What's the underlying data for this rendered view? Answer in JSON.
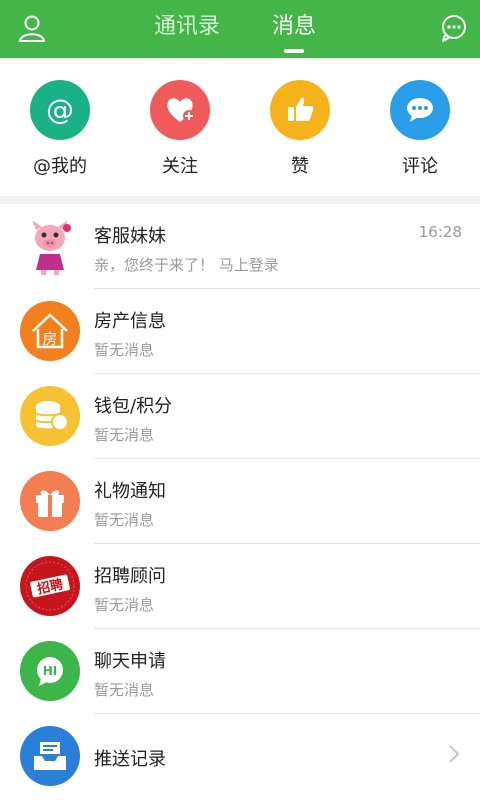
{
  "header": {
    "tabs": [
      {
        "label": "通讯录",
        "active": false
      },
      {
        "label": "消息",
        "active": true
      }
    ],
    "left_icon": "person-icon",
    "right_icon": "chat-bubble-icon",
    "bg_color": "#44b549"
  },
  "quick_actions": [
    {
      "label": "@我的",
      "icon": "at-sign-icon",
      "color": "#1ab184"
    },
    {
      "label": "关注",
      "icon": "heart-plus-icon",
      "color": "#f05a5a"
    },
    {
      "label": "赞",
      "icon": "thumbs-up-icon",
      "color": "#f6b21a"
    },
    {
      "label": "评论",
      "icon": "speech-bubble-icon",
      "color": "#2a9de8"
    }
  ],
  "messages": [
    {
      "title": "客服妹妹",
      "subtitle": "亲，您终于来了！ 马上登录",
      "time": "16:28",
      "icon": "pig-mascot-avatar"
    },
    {
      "title": "房产信息",
      "subtitle": "暂无消息",
      "icon": "house-icon",
      "icon_text": "房",
      "color": "#f2801e"
    },
    {
      "title": "钱包/积分",
      "subtitle": "暂无消息",
      "icon": "coins-icon",
      "color": "#f6c233"
    },
    {
      "title": "礼物通知",
      "subtitle": "暂无消息",
      "icon": "gift-icon",
      "color": "#f57d52"
    },
    {
      "title": "招聘顾问",
      "subtitle": "暂无消息",
      "icon": "recruit-badge-icon",
      "icon_text": "招聘",
      "color": "#c4161c"
    },
    {
      "title": "聊天申请",
      "subtitle": "暂无消息",
      "icon": "hi-bubble-icon",
      "icon_text": "HI",
      "color": "#3cb54a"
    }
  ],
  "push_record": {
    "title": "推送记录",
    "icon": "inbox-mail-icon",
    "color": "#2a7fd8",
    "chevron": "chevron-right-icon"
  }
}
